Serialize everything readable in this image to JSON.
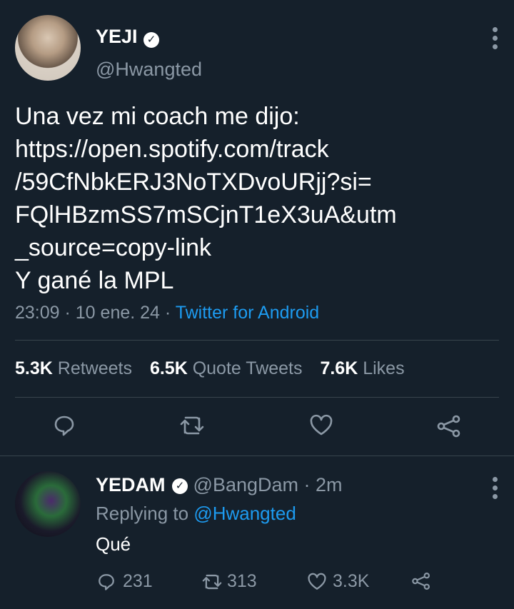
{
  "tweet": {
    "author_name": "YEJI",
    "author_handle": "@Hwangted",
    "text": "Una vez mi coach me dijo:\nhttps://open.spotify.com/track\n/59CfNbkERJ3NoTXDvoURjj?si=\nFQlHBzmSS7mSCjnT1eX3uA&utm\n_source=copy-link\nY gané la MPL",
    "time": "23:09",
    "date": "10 ene. 24",
    "source": "Twitter for Android",
    "separator": " · ",
    "retweets_count": "5.3K",
    "retweets_label": "Retweets",
    "quotes_count": "6.5K",
    "quotes_label": "Quote Tweets",
    "likes_count": "7.6K",
    "likes_label": "Likes"
  },
  "reply": {
    "author_name": "YEDAM",
    "author_handle": "@BangDam",
    "time_ago": "· 2m",
    "replying_prefix": "Replying to",
    "replying_to": "@Hwangted",
    "text": "Qué",
    "reply_count": "231",
    "retweet_count": "313",
    "like_count": "3.3K"
  },
  "icons": {
    "verified": "verified-badge-icon",
    "more": "more-vertical-icon",
    "reply": "reply-bubble-icon",
    "retweet": "retweet-icon",
    "like": "heart-icon",
    "share": "share-icon"
  },
  "colors": {
    "background": "#15202b",
    "link": "#1d9bf0",
    "secondary_text": "#8b98a5",
    "divider": "#38444d"
  }
}
